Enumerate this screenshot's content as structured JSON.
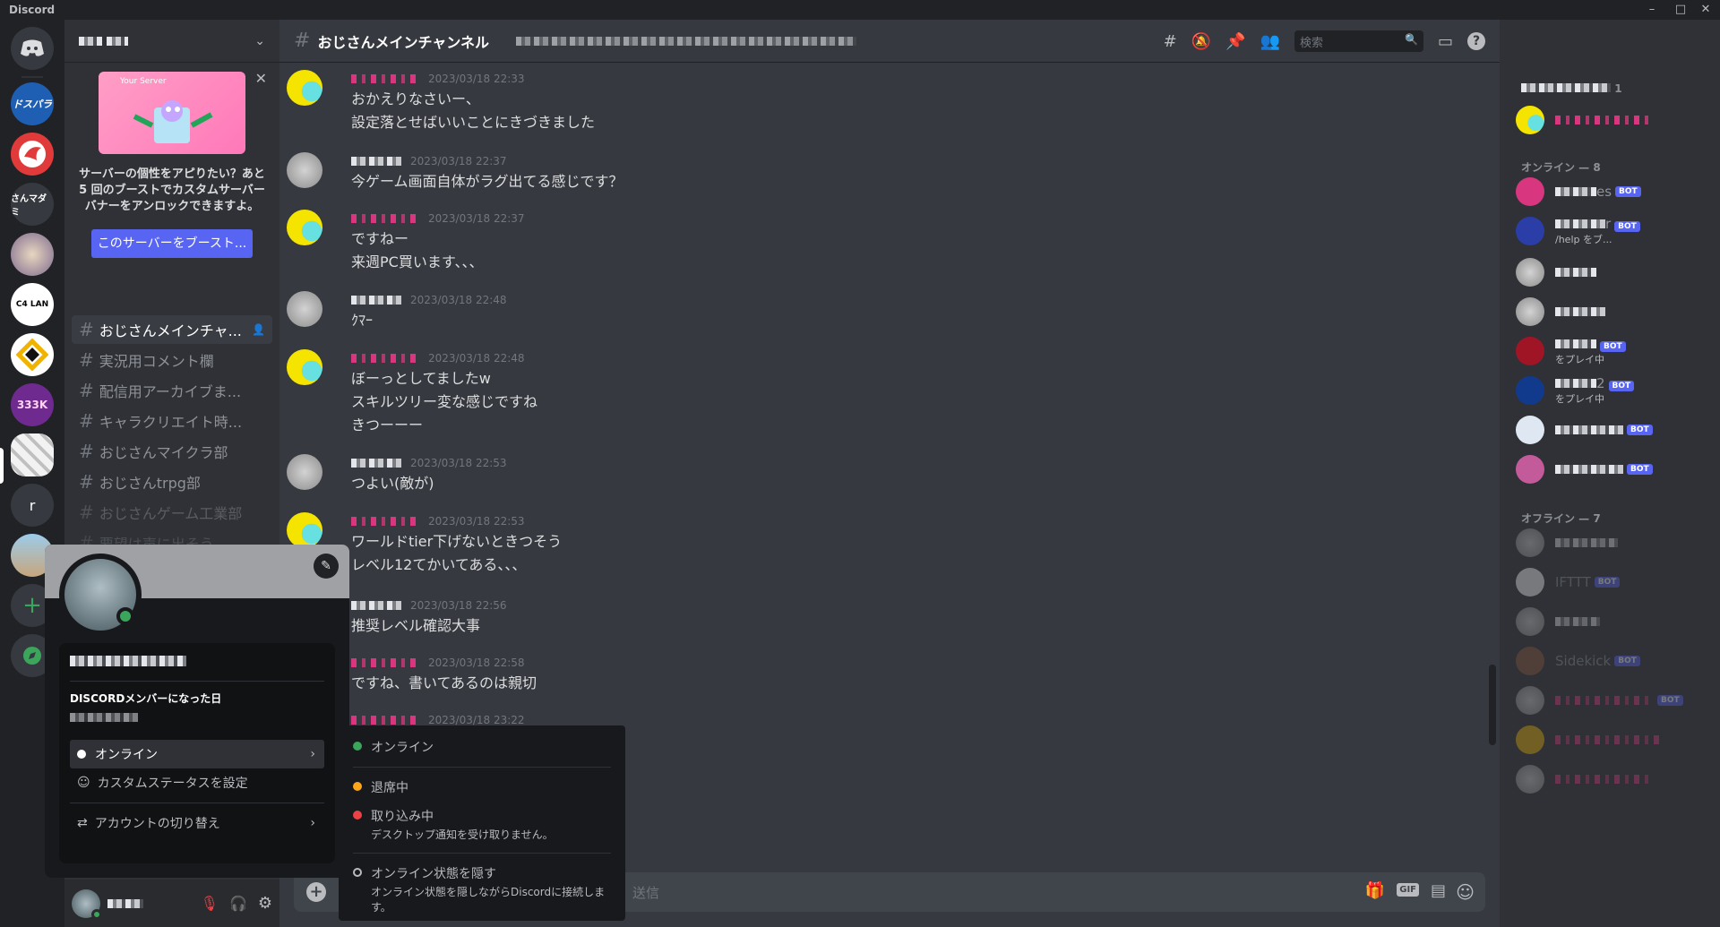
{
  "window": {
    "app_name": "Discord"
  },
  "rail": {
    "servers": [
      {
        "label": ""
      },
      {
        "label": "ドスパラ",
        "color": "#1e5fb4"
      },
      {
        "label": "",
        "color": "#e03a3a"
      },
      {
        "label": "さんマダミ"
      },
      {
        "label": ""
      },
      {
        "label": "C4 LAN"
      },
      {
        "label": ""
      },
      {
        "label": "333K"
      },
      {
        "label": ""
      },
      {
        "label": "r"
      }
    ]
  },
  "sidebar": {
    "boost": {
      "banner_label": "Your Server",
      "text": "サーバーの個性をアピりたい？あと5 回のブーストでカスタムサーバーバナーをアンロックできますよ。",
      "button": "このサーバーをブースト..."
    },
    "channels": [
      {
        "name": "おじさんメインチャ..."
      },
      {
        "name": "実況用コメント欄"
      },
      {
        "name": "配信用アーカイブま..."
      },
      {
        "name": "キャラクリエイト時..."
      },
      {
        "name": "おじさんマイクラ部"
      },
      {
        "name": "おじさんtrpg部"
      },
      {
        "name": "おじさんゲーム工業部"
      },
      {
        "name": "要望は声に出そう"
      }
    ]
  },
  "chat": {
    "channel_name": "おじさんメインチャンネル",
    "search_placeholder": "検索",
    "composer_placeholder": "送信",
    "composer_gif": "GIF",
    "messages": [
      {
        "time": "2023/03/18 22:33",
        "lines": [
          "おかえりなさいー、",
          "設定落とせばいいことにきづきました"
        ]
      },
      {
        "time": "2023/03/18 22:37",
        "lines": [
          "今ゲーム画面自体がラグ出てる感じです？"
        ]
      },
      {
        "time": "2023/03/18 22:37",
        "lines": [
          "ですねー",
          "来週PC買います、、、"
        ]
      },
      {
        "time": "2023/03/18 22:48",
        "lines": [
          "ｸﾏｰ"
        ]
      },
      {
        "time": "2023/03/18 22:48",
        "lines": [
          "ぼーっとしてましたw",
          "スキルツリー変な感じですね",
          "きつーーー"
        ]
      },
      {
        "time": "2023/03/18 22:53",
        "lines": [
          "つよい(敵が)"
        ]
      },
      {
        "time": "2023/03/18 22:53",
        "lines": [
          "ワールドtier下げないときつそう",
          "レベル12てかいてある、、、"
        ]
      },
      {
        "time": "2023/03/18 22:56",
        "lines": [
          "推奨レベル確認大事"
        ]
      },
      {
        "time": "2023/03/18 22:58",
        "lines": [
          "ですね、書いてあるのは親切"
        ]
      },
      {
        "time": "2023/03/18 23:22",
        "lines": []
      }
    ]
  },
  "members": {
    "group_top_count": "1",
    "online_header": "オンライン — 8",
    "offline_header": "オフライン — 7",
    "bot_label": "BOT",
    "online": [
      {
        "name": "es",
        "bot": true
      },
      {
        "name": "r",
        "bot": true,
        "activity": "/help をブ..."
      },
      {
        "name": "",
        "bot": false
      },
      {
        "name": "",
        "bot": false
      },
      {
        "name": "",
        "bot": true,
        "activity": "をプレイ中"
      },
      {
        "name": "2",
        "bot": true,
        "activity": "をプレイ中"
      },
      {
        "name": "",
        "bot": true
      },
      {
        "name": "",
        "bot": true
      }
    ],
    "offline": [
      {
        "name": "",
        "bot": false
      },
      {
        "name": "IFTTT",
        "bot": true
      },
      {
        "name": "",
        "bot": false
      },
      {
        "name": "Sidekick",
        "bot": true
      },
      {
        "name": "",
        "bot": true
      },
      {
        "name": "",
        "bot": false
      },
      {
        "name": "",
        "bot": false
      }
    ]
  },
  "profile": {
    "member_since_label": "DISCORDメンバーになった日",
    "status_current": "オンライン",
    "custom_status": "カスタムステータスを設定",
    "switch_account": "アカウントの切り替え"
  },
  "status_menu": {
    "online": "オンライン",
    "idle": "退席中",
    "dnd": "取り込み中",
    "dnd_desc": "デスクトップ通知を受け取りません。",
    "invisible": "オンライン状態を隠す",
    "invisible_desc": "オンライン状態を隠しながらDiscordに接続します。"
  },
  "colors": {
    "online": "#3ba55c",
    "idle": "#faa81a",
    "dnd": "#ed4245",
    "blurple": "#5865f2"
  },
  "icons": [
    "discord-icon",
    "hash-icon",
    "threads-icon",
    "mute-icon",
    "pin-icon",
    "members-icon",
    "search-icon",
    "inbox-icon",
    "help-icon",
    "gift-icon",
    "sticker-icon",
    "emoji-icon",
    "mic-icon",
    "headphones-icon",
    "settings-icon",
    "edit-icon",
    "chevron-right-icon"
  ]
}
